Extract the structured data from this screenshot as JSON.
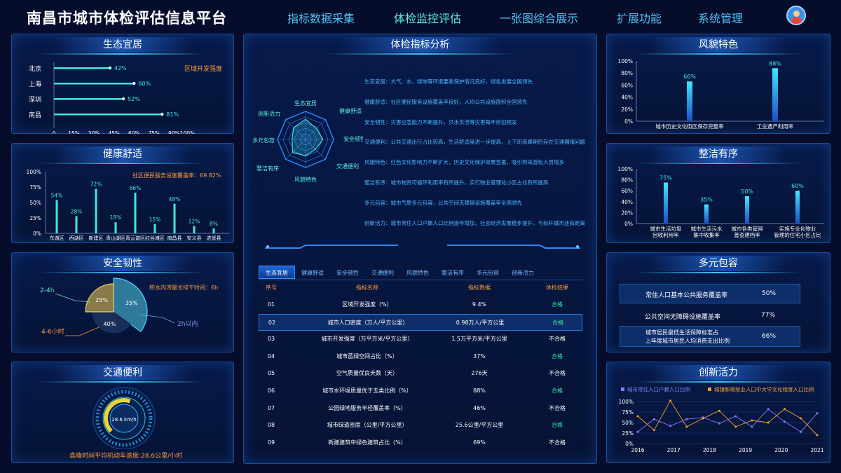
{
  "header": {
    "title": "南昌市城市体检评估信息平台",
    "nav": [
      "指标数据采集",
      "体检监控评估",
      "一张图综合展示",
      "扩展功能",
      "系统管理"
    ],
    "active_index": 1
  },
  "eco": {
    "title": "生态宜居",
    "note": "区域开发强度",
    "chart_data": {
      "type": "bar",
      "orientation": "horizontal",
      "categories": [
        "北京",
        "上海",
        "深圳",
        "南昌"
      ],
      "values": [
        42,
        60,
        52,
        81
      ],
      "value_labels": [
        "42%",
        "60%",
        "52%",
        "81%"
      ],
      "xticks": [
        "0",
        "15%",
        "30%",
        "45%",
        "60%",
        "75%",
        "90%",
        "100%"
      ],
      "xlim": [
        0,
        105
      ]
    }
  },
  "health": {
    "title": "健康舒适",
    "note": "社区便民服务设施覆盖率：69.82%",
    "chart_data": {
      "type": "bar",
      "categories": [
        "东湖区",
        "西湖区",
        "新建区",
        "青山湖区",
        "青云谱区",
        "红谷滩区",
        "南昌县",
        "安义县",
        "进贤县"
      ],
      "values": [
        54,
        28,
        72,
        18,
        66,
        15,
        48,
        12,
        8
      ],
      "value_labels": [
        "54%",
        "28%",
        "72%",
        "18%",
        "66%",
        "15%",
        "48%",
        "12%",
        "8%"
      ],
      "yticks": [
        "100%",
        "75%",
        "50%",
        "25%",
        "0%"
      ],
      "ylim": [
        0,
        100
      ]
    }
  },
  "safety": {
    "title": "安全韧性",
    "note": "积水内涝最长排干时间：6h",
    "chart_data": {
      "type": "pie",
      "slices": [
        {
          "label": "2-4h",
          "value": 35,
          "text": "35%"
        },
        {
          "label": "2h以内",
          "value": 40,
          "text": "40%"
        },
        {
          "label": "4-6小时",
          "value": 25,
          "text": "25%"
        }
      ]
    }
  },
  "traffic": {
    "title": "交通便利",
    "gauge_value": "28.6 km/h",
    "gauge_level": 0.57,
    "note": "高峰时间平均机动车速度:28.6公里/小时"
  },
  "analysis": {
    "title": "体检指标分析",
    "radar": {
      "axes": [
        "生态宜居",
        "健康舒适",
        "安全韧性",
        "交通便利",
        "风貌特色",
        "整洁有序",
        "多元包容",
        "创新活力"
      ],
      "values": [
        0.72,
        0.55,
        0.62,
        0.5,
        0.58,
        0.66,
        0.48,
        0.6
      ]
    },
    "items": [
      {
        "k": "生态宜居",
        "t": "大气、水、绿地等环境要素保护情况良好，绿色发展全国领先"
      },
      {
        "k": "健康舒适",
        "t": "社区便民服务设施覆盖率良好，人均公共设施面积全国领先"
      },
      {
        "k": "安全韧性",
        "t": "灾害应急能力不断提升，洪水洪涝等灾害每年依旧频发"
      },
      {
        "k": "交通便利",
        "t": "公共交通出行占比较高，生活舒适度进一步提高，上下班高峰期仍存在交通拥堵问题"
      },
      {
        "k": "风貌特色",
        "t": "红色文化影响力不断扩大，历史文化保护效果显著，吸引到来游玩人员增多"
      },
      {
        "k": "整洁有序",
        "t": "城市物资可循环利用率有所提升，实行物业管理化小区占比有所提高"
      },
      {
        "k": "多元包容",
        "t": "城市气质多元包容，公共空间无障碍设施覆盖率全国领先"
      },
      {
        "k": "创新活力",
        "t": "城市常住人口户籍人口比例逐年增加，社会经济发展稳步提升，与标杆城市还有距离"
      }
    ]
  },
  "table": {
    "tabs": [
      "生态宜居",
      "健康舒适",
      "安全韧性",
      "交通便利",
      "风貌特色",
      "整洁有序",
      "多元包容",
      "创新活力"
    ],
    "active_tab": 0,
    "headers": [
      "序号",
      "指标名称",
      "指标数据",
      "体检结果"
    ],
    "rows": [
      [
        "01",
        "区域开发强度（%）",
        "9.4%",
        "合格"
      ],
      [
        "02",
        "城市人口密度（万人/平方公里）",
        "0.98万人/平方公里",
        "合格"
      ],
      [
        "03",
        "城市开发强度（万平方米/平方公里）",
        "1.5万平方米/平方公里",
        "不合格"
      ],
      [
        "04",
        "城市蓝绿空间占比（%）",
        "37%",
        "合格"
      ],
      [
        "05",
        "空气质量优良天数（天）",
        "276天",
        "不合格"
      ],
      [
        "06",
        "城市水环境质量优于五类比例（%）",
        "88%",
        "合格"
      ],
      [
        "07",
        "公园绿地服务半径覆盖率（%）",
        "46%",
        "不合格"
      ],
      [
        "08",
        "城市绿道密度（公里/平方公里）",
        "25.6公里/平方公里",
        "合格"
      ],
      [
        "09",
        "新建建筑中绿色建筑占比（%）",
        "69%",
        "不合格"
      ]
    ],
    "highlight_row": 1
  },
  "style": {
    "title": "风貌特色",
    "chart_data": {
      "type": "bar",
      "categories": [
        "城市历史文化街区保存完整率",
        "工业遗产利用率"
      ],
      "values": [
        66,
        88
      ],
      "value_labels": [
        "66%",
        "88%"
      ],
      "yticks": [
        "100%",
        "80%",
        "60%",
        "40%",
        "20%",
        "0%"
      ],
      "ylim": [
        0,
        100
      ]
    }
  },
  "order": {
    "title": "整洁有序",
    "chart_data": {
      "type": "bar",
      "categories": [
        [
          "城市生活垃圾",
          "回收利用率"
        ],
        [
          "城市生活污水",
          "集中收集率"
        ],
        [
          "城市各类管网",
          "普查建档率"
        ],
        [
          "实施专业化物业",
          "管理的住宅小区占比"
        ]
      ],
      "values": [
        75,
        35,
        50,
        60
      ],
      "value_labels": [
        "75%",
        "35%",
        "50%",
        "60%"
      ],
      "yticks": [
        "100%",
        "80%",
        "60%",
        "40%",
        "20%",
        "0%"
      ],
      "ylim": [
        0,
        100
      ]
    }
  },
  "diverse": {
    "title": "多元包容",
    "rows": [
      {
        "label": "常住人口基本公共服务覆盖率",
        "value": "50%"
      },
      {
        "label": "公共空间无障碍设施覆盖率",
        "value": "77%"
      },
      {
        "label": [
          "城市居民最低生活保障标准占",
          "上年度城市居民人均消费支出比例"
        ],
        "value": "66%"
      }
    ]
  },
  "innov": {
    "title": "创新活力",
    "chart_data": {
      "type": "line",
      "x": [
        "2016",
        "2017",
        "2018",
        "2019",
        "2020",
        "2021"
      ],
      "yticks": [
        "100%",
        "75%",
        "50%",
        "25%",
        "0%"
      ],
      "ylim": [
        0,
        100
      ],
      "series": [
        {
          "name": "城市常住人口户籍人口比例",
          "color": "#8a7cff",
          "values": [
            28,
            58,
            42,
            58,
            62,
            48,
            65,
            40,
            82,
            52,
            28,
            72
          ]
        },
        {
          "name": "城镇新增就业人口中大学文化程度人口比例",
          "color": "#f0a030",
          "values": [
            65,
            32,
            102,
            40,
            60,
            78,
            40,
            55,
            50,
            82,
            60,
            20
          ]
        }
      ]
    }
  }
}
